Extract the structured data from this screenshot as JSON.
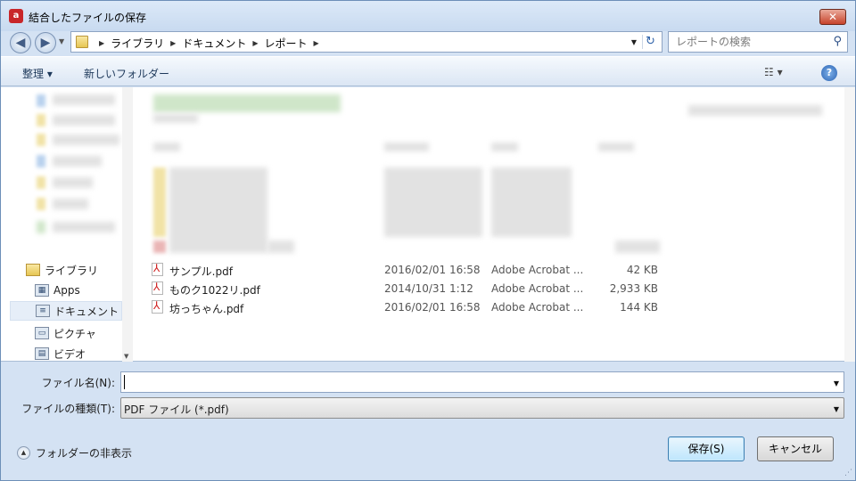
{
  "window": {
    "title": "結合したファイルの保存",
    "close_glyph": "✕"
  },
  "nav": {
    "back_glyph": "◀",
    "forward_glyph": "▶",
    "breadcrumbs": [
      "ライブラリ",
      "ドキュメント",
      "レポート"
    ],
    "search_placeholder": "レポートの検索"
  },
  "toolbar": {
    "organize": "整理 ▾",
    "new_folder": "新しいフォルダー",
    "view_glyph": "☷ ▾",
    "help_glyph": "?"
  },
  "sidebar": {
    "items": [
      {
        "label": "ライブラリ",
        "icon": "library-icon"
      },
      {
        "label": "Apps",
        "icon": "apps-icon"
      },
      {
        "label": "ドキュメント",
        "icon": "documents-icon"
      },
      {
        "label": "ピクチャ",
        "icon": "pictures-icon"
      },
      {
        "label": "ビデオ",
        "icon": "video-icon"
      }
    ]
  },
  "files": [
    {
      "name": "サンプル.pdf",
      "date": "2016/02/01 16:58",
      "type": "Adobe Acrobat ...",
      "size": "42 KB"
    },
    {
      "name": "ものク1022リ.pdf",
      "date": "2014/10/31 1:12",
      "type": "Adobe Acrobat ...",
      "size": "2,933 KB"
    },
    {
      "name": "坊っちゃん.pdf",
      "date": "2016/02/01 16:58",
      "type": "Adobe Acrobat ...",
      "size": "144 KB"
    }
  ],
  "form": {
    "filename_label": "ファイル名(N):",
    "filename_value": "",
    "filetype_label": "ファイルの種類(T):",
    "filetype_value": "PDF ファイル (*.pdf)"
  },
  "footer": {
    "hide_folders": "フォルダーの非表示",
    "save": "保存(S)",
    "cancel": "キャンセル"
  },
  "colors": {
    "window_frame": "#d4e2f3",
    "close_red": "#c7432a",
    "accent": "#3c7fb1"
  }
}
